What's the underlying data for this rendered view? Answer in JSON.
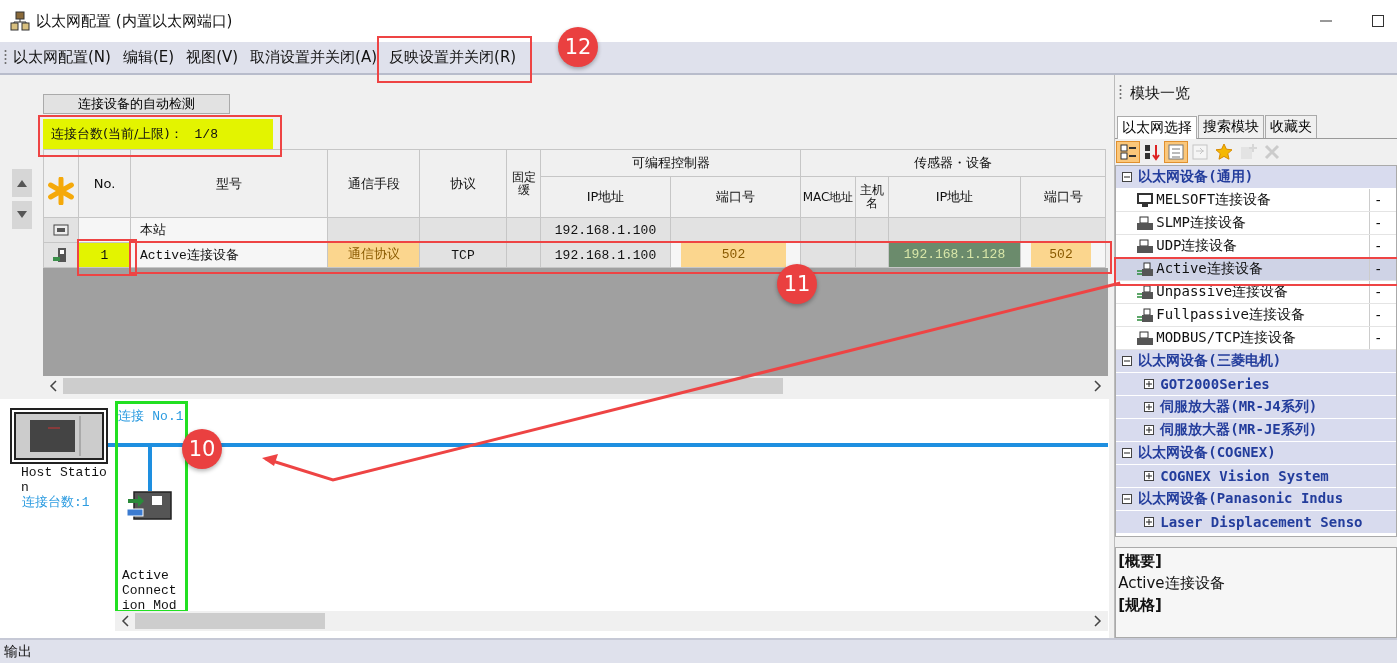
{
  "window": {
    "title": "以太网配置 (内置以太网端口)"
  },
  "menu": [
    "以太网配置(N)",
    "编辑(E)",
    "视图(V)",
    "取消设置并关闭(A)",
    "反映设置并关闭(R)"
  ],
  "auto_detect_button": "连接设备的自动检测",
  "connection_count": {
    "label": "连接台数(当前/上限)：",
    "value": "1/8"
  },
  "table": {
    "columns": [
      {
        "kind": "marker"
      },
      {
        "label": "No."
      },
      {
        "label": "型号"
      },
      {
        "label": "通信手段"
      },
      {
        "label": "协议"
      },
      {
        "label": "固定缓"
      },
      {
        "label": "IP地址",
        "kind": "sub"
      },
      {
        "label": "端口号",
        "kind": "sub"
      },
      {
        "label": "MAC地址",
        "kind": "sub"
      },
      {
        "label": "主机名",
        "kind": "sub"
      },
      {
        "label": "IP地址",
        "kind": "sub"
      },
      {
        "label": "端口号",
        "kind": "sub"
      }
    ],
    "column_groups": [
      {
        "label": "可编程控制器"
      },
      {
        "label": "传感器・设备"
      }
    ],
    "rows": [
      {
        "kind": "station",
        "cells": [
          {
            "kind": "icon"
          },
          {
            "kind": "plain"
          },
          {
            "text": "本站",
            "kind": "plain"
          },
          {
            "kind": "gray"
          },
          {
            "kind": "gray"
          },
          {
            "kind": "gray"
          },
          {
            "text": "192.168.1.100",
            "kind": "gray"
          },
          {
            "kind": "gray"
          },
          {
            "kind": "gray"
          },
          {
            "kind": "gray"
          },
          {
            "kind": "gray"
          },
          {
            "kind": "gray"
          }
        ]
      },
      {
        "kind": "connection",
        "cells": [
          {
            "kind": "icon"
          },
          {
            "text": "1",
            "kind": "highlight"
          },
          {
            "text": "Active连接设备",
            "kind": "plain"
          },
          {
            "text": "通信协议",
            "kind": "input"
          },
          {
            "text": "TCP",
            "kind": "gray"
          },
          {
            "kind": "gray"
          },
          {
            "text": "192.168.1.100",
            "kind": "gray"
          },
          {
            "text": "502",
            "kind": "input"
          },
          {
            "kind": "gray"
          },
          {
            "kind": "gray"
          },
          {
            "text": "192.168.1.128",
            "kind": "green"
          },
          {
            "text": "502",
            "kind": "input"
          }
        ]
      }
    ]
  },
  "diagram": {
    "host": {
      "label": "Host Station",
      "count": "连接台数:1"
    },
    "connections": [
      {
        "label": "连接 No.1",
        "module": "Active Connection Mod"
      }
    ]
  },
  "module_list": {
    "title": "模块一览",
    "tabs": [
      {
        "label": "以太网选择",
        "selected": true
      },
      {
        "label": "搜索模块",
        "selected": false
      },
      {
        "label": "收藏夹",
        "selected": false
      }
    ],
    "toolbar": [
      {
        "kind": "category",
        "on": true,
        "disabled": false
      },
      {
        "kind": "alpha",
        "on": false,
        "disabled": false
      },
      {
        "kind": "expand",
        "on": true,
        "disabled": false
      },
      {
        "kind": "collapse",
        "on": false,
        "disabled": true
      },
      {
        "kind": "star",
        "on": false,
        "disabled": false
      },
      {
        "kind": "add",
        "on": false,
        "disabled": true
      },
      {
        "kind": "delete",
        "on": false,
        "disabled": true
      }
    ],
    "tree": [
      {
        "label": "以太网设备(通用)",
        "expanded": true,
        "children": [
          {
            "kind": "device",
            "label": "MELSOFT连接设备",
            "value": "-",
            "selected": false
          },
          {
            "kind": "device",
            "label": "SLMP连接设备",
            "value": "-",
            "selected": false
          },
          {
            "kind": "device",
            "label": "UDP连接设备",
            "value": "-",
            "selected": false
          },
          {
            "kind": "device",
            "label": "Active连接设备",
            "value": "-",
            "selected": true
          },
          {
            "kind": "device",
            "label": "Unpassive连接设备",
            "value": "-",
            "selected": false
          },
          {
            "kind": "device",
            "label": "Fullpassive连接设备",
            "value": "-",
            "selected": false
          },
          {
            "kind": "device",
            "label": "MODBUS/TCP连接设备",
            "value": "-",
            "selected": false
          }
        ]
      },
      {
        "label": "以太网设备(三菱电机)",
        "expanded": true,
        "children": [
          {
            "kind": "folder",
            "label": "GOT2000Series",
            "expanded": false
          },
          {
            "kind": "folder",
            "label": "伺服放大器(MR-J4系列)",
            "expanded": false
          },
          {
            "kind": "folder",
            "label": "伺服放大器(MR-JE系列)",
            "expanded": false
          }
        ]
      },
      {
        "label": "以太网设备(COGNEX)",
        "expanded": true,
        "children": [
          {
            "kind": "folder",
            "label": "COGNEX Vision System",
            "expanded": false
          }
        ]
      },
      {
        "label": "以太网设备(Panasonic Indus",
        "expanded": true,
        "children": [
          {
            "kind": "folder",
            "label": "Laser Displacement Senso",
            "expanded": false
          }
        ]
      }
    ],
    "description": [
      {
        "heading": "[概要]",
        "text": "Active连接设备"
      },
      {
        "heading": "[规格]"
      }
    ]
  },
  "output_bar": "输出",
  "annotations": [
    {
      "number": "12"
    },
    {
      "number": "11"
    },
    {
      "number": "10"
    }
  ]
}
